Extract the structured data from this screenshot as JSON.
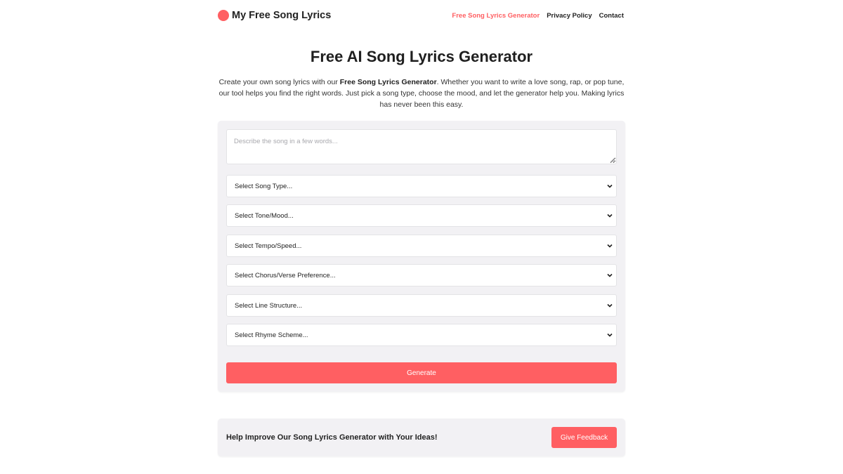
{
  "header": {
    "brand": "My Free Song Lyrics",
    "nav": [
      {
        "label": "Free Song Lyrics Generator",
        "active": true
      },
      {
        "label": "Privacy Policy",
        "active": false
      },
      {
        "label": "Contact",
        "active": false
      }
    ]
  },
  "hero": {
    "title": "Free AI Song Lyrics Generator",
    "intro_before": "Create your own song lyrics with our ",
    "intro_bold": "Free Song Lyrics Generator",
    "intro_after": ". Whether you want to write a love song, rap, or pop tune, our tool helps you find the right words. Just pick a song type, choose the mood, and let the generator help you. Making lyrics has never been this easy."
  },
  "form": {
    "description_placeholder": "Describe the song in a few words...",
    "selects": [
      {
        "id": "song-type",
        "label": "Select Song Type..."
      },
      {
        "id": "tone-mood",
        "label": "Select Tone/Mood..."
      },
      {
        "id": "tempo-speed",
        "label": "Select Tempo/Speed..."
      },
      {
        "id": "chorus-verse",
        "label": "Select Chorus/Verse Preference..."
      },
      {
        "id": "line-structure",
        "label": "Select Line Structure..."
      },
      {
        "id": "rhyme-scheme",
        "label": "Select Rhyme Scheme..."
      }
    ],
    "generate_label": "Generate"
  },
  "feedback": {
    "text": "Help Improve Our Song Lyrics Generator with Your Ideas!",
    "button_label": "Give Feedback"
  },
  "colors": {
    "accent": "#ff5f62",
    "card_bg": "#f2f1f4",
    "text": "#222222"
  },
  "icons": {
    "brand": "circle-logo-icon",
    "select": "chevron-down-icon",
    "textarea": "resize-grip-icon"
  }
}
